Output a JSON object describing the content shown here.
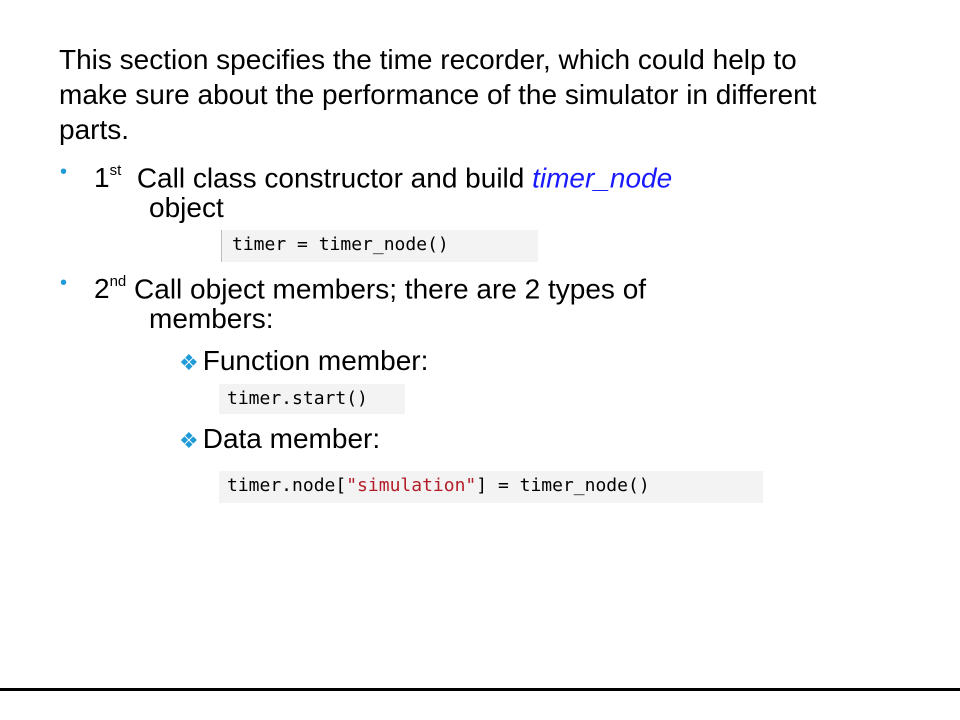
{
  "intro": "This section specifies the time recorder, which could help to make sure about the performance of the simulator in different parts.",
  "bullets": [
    {
      "num": "1",
      "sup": "st",
      "text_before": "Call class constructor and build ",
      "highlight": "timer_node",
      "text_after": "object",
      "code": "timer = timer_node()"
    },
    {
      "num": "2",
      "sup": "nd",
      "text_line1": "Call object members; there are 2 types of",
      "text_line2": "members:",
      "subitems": [
        {
          "label": "Function member:",
          "code": "timer.start()"
        },
        {
          "label": "Data member:",
          "code_prefix": "timer.node[",
          "code_string": "\"simulation\"",
          "code_suffix": "] = timer_node()"
        }
      ]
    }
  ],
  "icons": {
    "bullet": "bullet-dot-icon",
    "subbullet": "diamond-four-icon"
  },
  "colors": {
    "bullet": "#1f9bd7",
    "highlight": "#1a1aff",
    "string": "#b31d28",
    "code_bg": "#f3f3f3"
  }
}
